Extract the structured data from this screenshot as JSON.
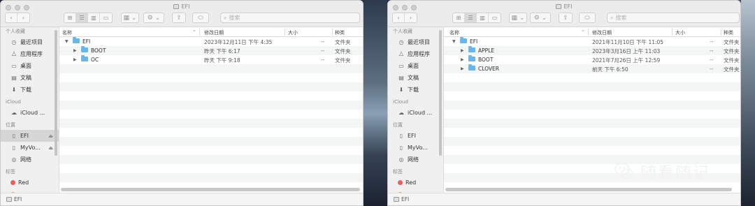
{
  "colors": {
    "folder": "#69b6ea",
    "tag_red": "#ec5f57",
    "tag_orange": "#f0a13a",
    "selected": "#d6d6d6"
  },
  "left_window": {
    "title": "EFI",
    "search_placeholder": "搜索",
    "sidebar": {
      "favorites_header": "个人收藏",
      "favorites": [
        {
          "label": "最近项目",
          "icon": "clock-icon"
        },
        {
          "label": "应用程序",
          "icon": "apps-icon"
        },
        {
          "label": "桌面",
          "icon": "desktop-icon"
        },
        {
          "label": "文稿",
          "icon": "document-icon"
        },
        {
          "label": "下载",
          "icon": "download-icon"
        }
      ],
      "icloud_header": "iCloud",
      "icloud": [
        {
          "label": "iCloud ...",
          "icon": "cloud-icon"
        }
      ],
      "locations_header": "位置",
      "locations": [
        {
          "label": "EFI",
          "icon": "disk-icon",
          "selected": true,
          "eject": "⏏"
        },
        {
          "label": "MyVo...",
          "icon": "disk-icon",
          "selected": false,
          "eject": "⏏"
        },
        {
          "label": "网络",
          "icon": "network-icon",
          "selected": false,
          "eject": ""
        }
      ],
      "tags_header": "标签",
      "tags": [
        {
          "label": "Red",
          "icon": "red-tag-icon"
        }
      ]
    },
    "columns": {
      "name": "名称",
      "date": "修改日期",
      "size": "大小",
      "kind": "种类"
    },
    "rows": [
      {
        "name": "EFI",
        "date": "2023年12月11日 下午 4:35",
        "size": "--",
        "kind": "文件夹",
        "expanded": true,
        "indent": 0
      },
      {
        "name": "BOOT",
        "date": "昨天 下午 6:17",
        "size": "--",
        "kind": "文件夹",
        "expanded": false,
        "indent": 1
      },
      {
        "name": "OC",
        "date": "昨天 下午 9:18",
        "size": "--",
        "kind": "文件夹",
        "expanded": false,
        "indent": 1
      }
    ],
    "path": "EFI"
  },
  "right_window": {
    "title": "EFI",
    "search_placeholder": "搜索",
    "sidebar": {
      "favorites_header": "个人收藏",
      "favorites": [
        {
          "label": "最近项目",
          "icon": "clock-icon"
        },
        {
          "label": "应用程序",
          "icon": "apps-icon"
        },
        {
          "label": "桌面",
          "icon": "desktop-icon"
        },
        {
          "label": "文稿",
          "icon": "document-icon"
        },
        {
          "label": "下载",
          "icon": "download-icon"
        }
      ],
      "icloud_header": "iCloud",
      "icloud": [
        {
          "label": "iCloud ...",
          "icon": "cloud-icon"
        }
      ],
      "locations_header": "位置",
      "locations": [
        {
          "label": "EFI",
          "icon": "disk-icon",
          "selected": false,
          "eject": ""
        },
        {
          "label": "MyVo...",
          "icon": "disk-icon",
          "selected": false,
          "eject": ""
        },
        {
          "label": "网络",
          "icon": "network-icon",
          "selected": false,
          "eject": ""
        }
      ],
      "tags_header": "标签",
      "tags": [
        {
          "label": "Red",
          "icon": "red-tag-icon"
        }
      ]
    },
    "columns": {
      "name": "名称",
      "date": "修改日期",
      "size": "大小",
      "kind": "种类"
    },
    "rows": [
      {
        "name": "EFI",
        "date": "2021年11月10日 下午 11:05",
        "size": "--",
        "kind": "文件夹",
        "expanded": true,
        "indent": 0
      },
      {
        "name": "APPLE",
        "date": "2023年3月16日 上午 11:03",
        "size": "--",
        "kind": "文件夹",
        "expanded": false,
        "indent": 1
      },
      {
        "name": "BOOT",
        "date": "2021年7月26日 上午 12:59",
        "size": "--",
        "kind": "文件夹",
        "expanded": false,
        "indent": 1
      },
      {
        "name": "CLOVER",
        "date": "前天 下午 6:50",
        "size": "--",
        "kind": "文件夹",
        "expanded": false,
        "indent": 1
      }
    ],
    "path": "EFI"
  },
  "watermark": {
    "text": "随看随记",
    "icon": "wechat-icon"
  }
}
